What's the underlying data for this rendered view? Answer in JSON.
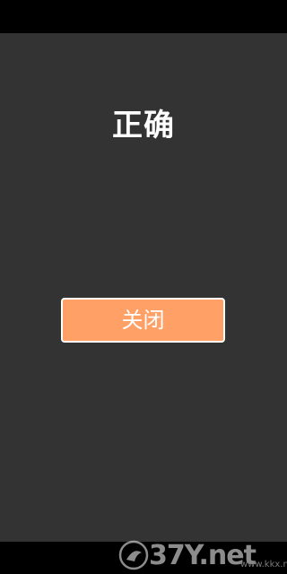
{
  "dialog": {
    "title": "正确",
    "close_label": "关闭"
  },
  "watermark": {
    "site": "37Y.net",
    "sub": "www.kkx.net"
  },
  "colors": {
    "screen_background": "#000000",
    "panel_background": "#333333",
    "button_fill": "#ffa066",
    "button_border": "#ffffff",
    "text": "#ffffff"
  }
}
